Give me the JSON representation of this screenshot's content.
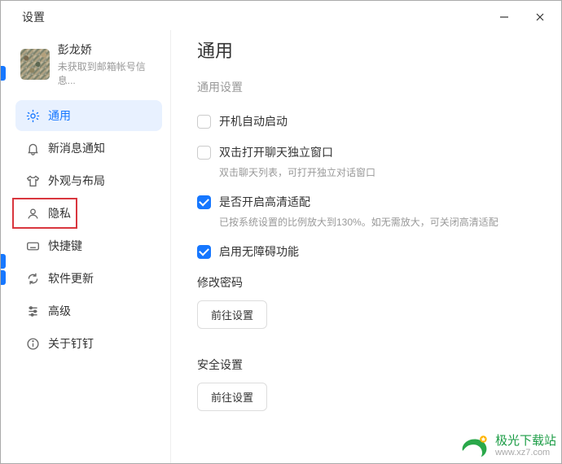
{
  "window": {
    "title": "设置"
  },
  "profile": {
    "name": "彭龙娇",
    "sub": "未获取到邮箱帐号信息..."
  },
  "sidebar": {
    "items": [
      {
        "label": "通用"
      },
      {
        "label": "新消息通知"
      },
      {
        "label": "外观与布局"
      },
      {
        "label": "隐私"
      },
      {
        "label": "快捷键"
      },
      {
        "label": "软件更新"
      },
      {
        "label": "高级"
      },
      {
        "label": "关于钉钉"
      }
    ]
  },
  "content": {
    "heading": "通用",
    "section_label": "通用设置",
    "autostart": {
      "label": "开机自动启动"
    },
    "dblclick": {
      "label": "双击打开聊天独立窗口",
      "desc": "双击聊天列表，可打开独立对话窗口"
    },
    "hidpi": {
      "label": "是否开启高清适配",
      "desc": "已按系统设置的比例放大到130%。如无需放大，可关闭高清适配"
    },
    "accessibility": {
      "label": "启用无障碍功能"
    },
    "password": {
      "label": "修改密码",
      "button": "前往设置"
    },
    "security": {
      "label": "安全设置",
      "button": "前往设置"
    }
  },
  "brand": {
    "name": "极光下载站",
    "url": "www.xz7.com"
  }
}
